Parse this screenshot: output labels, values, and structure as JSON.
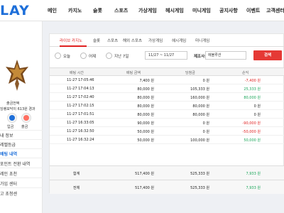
{
  "header": {
    "logo": "LAY",
    "nav": [
      "메인",
      "카지노",
      "슬롯",
      "스포츠",
      "가상게임",
      "헤시게임",
      "미니게임",
      "공지사항",
      "이벤트",
      "고객센터"
    ]
  },
  "sidebar": {
    "level_text": "출금전액",
    "rank_text": "잉랭모닥이 613원 경과",
    "deposit_label": "입금",
    "withdraw_label": "출금",
    "items": [
      "내 정보",
      "레벨등급",
      "배팅 내역",
      "포인트 전환 내역",
      "레인 초천",
      "가입 센터",
      "고 초청센"
    ]
  },
  "tabs": [
    {
      "label": "라이브 카지노",
      "active": true
    },
    {
      "label": "슬롯",
      "active": false
    },
    {
      "label": "스포츠",
      "active": false
    },
    {
      "label": "해외 스포츠",
      "active": false
    },
    {
      "label": "가상게임",
      "active": false
    },
    {
      "label": "헤시게임",
      "active": false
    },
    {
      "label": "미니게임",
      "active": false
    }
  ],
  "filters": {
    "periods": [
      "오늘",
      "어제",
      "지난 7일"
    ],
    "date_range": "11/27 ~ 11/27",
    "search_label": "제조사:",
    "search_value": "에볼루션",
    "search_button": "검색"
  },
  "table": {
    "columns": [
      "배팅 시간",
      "배팅 금액",
      "당첨금",
      "손익"
    ],
    "rows": [
      {
        "time": "11-27 17:05:46",
        "bet": "7,400 원",
        "win": "0 원",
        "profit": "-7,400 원",
        "tone": "red"
      },
      {
        "time": "11-27 17:04:13",
        "bet": "80,000 원",
        "win": "105,333 원",
        "profit": "25,333 원",
        "tone": "green"
      },
      {
        "time": "11-27 17:02:40",
        "bet": "80,000 원",
        "win": "160,000 원",
        "profit": "80,000 원",
        "tone": "green"
      },
      {
        "time": "11-27 17:02:15",
        "bet": "80,000 원",
        "win": "80,000 원",
        "profit": "0 원",
        "tone": "neutral"
      },
      {
        "time": "11-27 17:01:51",
        "bet": "80,000 원",
        "win": "80,000 원",
        "profit": "0 원",
        "tone": "neutral"
      },
      {
        "time": "11-27 16:33:05",
        "bet": "90,000 원",
        "win": "0 원",
        "profit": "-90,000 원",
        "tone": "red"
      },
      {
        "time": "11-27 16:32:50",
        "bet": "50,000 원",
        "win": "0 원",
        "profit": "-50,000 원",
        "tone": "red"
      },
      {
        "time": "11-27 16:32:24",
        "bet": "50,000 원",
        "win": "100,000 원",
        "profit": "50,000 원",
        "tone": "green"
      }
    ],
    "summary": [
      {
        "label": "합계",
        "bet": "517,400 원",
        "win": "525,333 원",
        "profit": "7,933 원"
      },
      {
        "label": "전체",
        "bet": "517,400 원",
        "win": "525,333 원",
        "profit": "7,933 원"
      }
    ]
  },
  "colors": {
    "accent": "#1e6fd9",
    "loss": "#e02020",
    "gain": "#18a558",
    "search_button": "#e53935"
  }
}
